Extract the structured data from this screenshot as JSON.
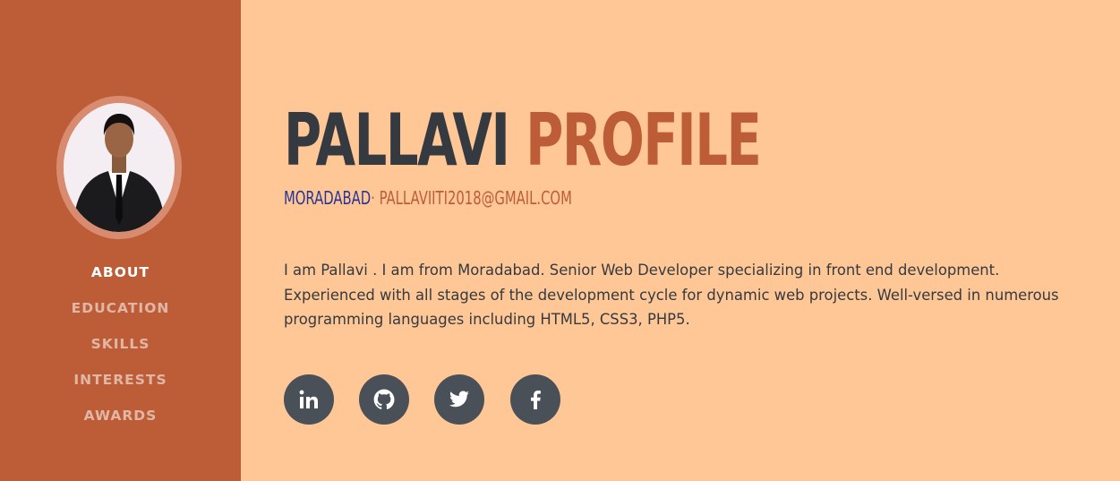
{
  "nav": {
    "items": [
      {
        "label": "ABOUT"
      },
      {
        "label": "EDUCATION"
      },
      {
        "label": "SKILLS"
      },
      {
        "label": "INTERESTS"
      },
      {
        "label": "AWARDS"
      }
    ],
    "active": "ABOUT"
  },
  "profile": {
    "first_name": "PALLAVI",
    "last_name": "PROFILE",
    "location": "MORADABAD",
    "separator": "·",
    "email": "PALLAVIITI2018@GMAIL.COM",
    "bio": "I am Pallavi . I am from Moradabad. Senior Web Developer specializing in front end development. Experienced with all stages of the development cycle for dynamic web projects. Well-versed in numerous programming languages including HTML5, CSS3, PHP5."
  },
  "social": [
    {
      "icon": "linkedin-icon"
    },
    {
      "icon": "github-icon"
    },
    {
      "icon": "twitter-icon"
    },
    {
      "icon": "facebook-icon"
    }
  ],
  "colors": {
    "sidebar": "#bd5d38",
    "background": "#ffc796",
    "accent": "#bd5d38",
    "dark": "#343a40",
    "location": "#283593",
    "social_button": "#495057"
  }
}
